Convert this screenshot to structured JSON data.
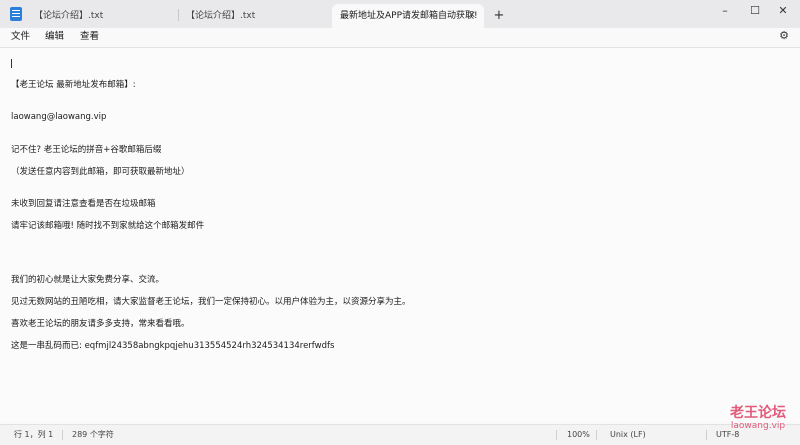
{
  "tabs": [
    {
      "label": "【论坛介绍】.txt",
      "active": false
    },
    {
      "label": "【论坛介绍】.txt",
      "active": false
    },
    {
      "label": "最新地址及APP请发邮箱自动获取!",
      "active": true
    }
  ],
  "new_tab_symbol": "+",
  "window_controls": {
    "minimize": "–",
    "maximize": "☐",
    "close": "✕"
  },
  "menu": [
    "文件",
    "编辑",
    "查看"
  ],
  "content_lines": [
    "【老王论坛 最新地址发布邮箱】:",
    "laowang@laowang.vip",
    "记不住? 老王论坛的拼音+谷歌邮箱后缀",
    "（发送任意内容到此邮箱，即可获取最新地址）",
    "未收到回复请注意查看是否在垃圾邮箱",
    "请牢记该邮箱哦! 随时找不到家就给这个邮箱发邮件",
    "我们的初心就是让大家免费分享、交流。",
    "见过无数网站的丑陋吃相，请大家监督老王论坛，我们一定保持初心。以用户体验为主，以资源分享为主。",
    "喜欢老王论坛的朋友请多多支持，常来看看哦。",
    "这是一串乱码而已: eqfmjl24358abngkpqjehu313554524rh324534134rerfwdfs"
  ],
  "status": {
    "position": "行 1，列 1",
    "char_count": "289 个字符",
    "zoom": "100%",
    "line_ending": "Unix (LF)",
    "encoding": "UTF-8"
  },
  "watermark": {
    "title": "老王论坛",
    "url": "laowang.vip"
  },
  "icons": {
    "settings": "gear-icon",
    "app": "notepad-icon"
  },
  "colors": {
    "titlebar": "#e9e9eb",
    "watermark": "#e15b7a",
    "app_icon": "#2b7fd8"
  }
}
